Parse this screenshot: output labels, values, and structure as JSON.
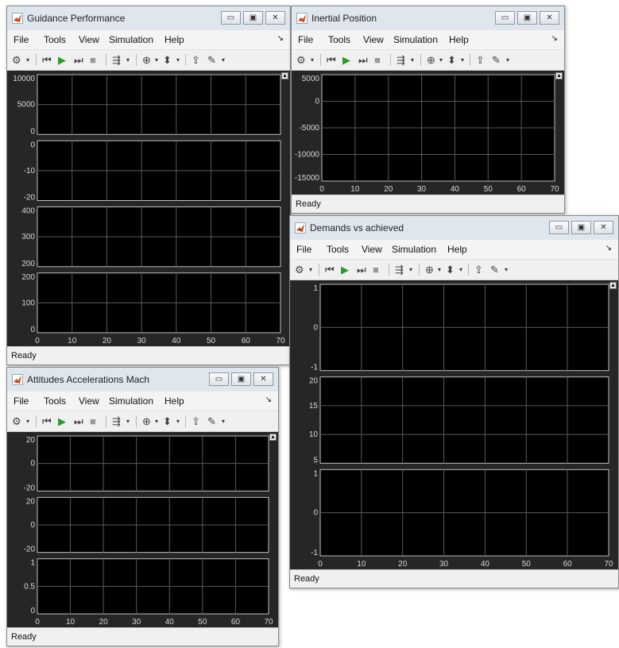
{
  "menu": [
    "File",
    "Tools",
    "View",
    "Simulation",
    "Help"
  ],
  "status_text": "Ready",
  "x_ticks": [
    "0",
    "10",
    "20",
    "30",
    "40",
    "50",
    "60",
    "70"
  ],
  "colors": {
    "scope_bg": "#262626",
    "plot_bg": "#000000",
    "grid": "#5a5a5a",
    "axes_box": "#bfbfbf",
    "tick_text": "#d8d8d8"
  },
  "icons": [
    "settings-icon",
    "step-back-icon",
    "run-icon",
    "step-forward-icon",
    "stop-icon",
    "highlight-icon",
    "zoom-icon",
    "scale-axes-icon",
    "signal-select-icon",
    "style-icon"
  ],
  "windows": [
    {
      "id": "guidance",
      "title": "Guidance Performance",
      "axes": [
        {
          "yticks": [
            "10000",
            "5000",
            "0"
          ],
          "xticks": false
        },
        {
          "yticks": [
            "0",
            "-10",
            "-20"
          ],
          "xticks": false
        },
        {
          "yticks": [
            "400",
            "300",
            "200"
          ],
          "xticks": false
        },
        {
          "yticks": [
            "200",
            "100",
            "0"
          ],
          "xticks": true
        }
      ]
    },
    {
      "id": "inertial",
      "title": "Inertial Position",
      "axes": [
        {
          "yticks": [
            "5000",
            "0",
            "-5000",
            "-10000",
            "-15000"
          ],
          "xticks": true
        }
      ]
    },
    {
      "id": "demands",
      "title": "Demands vs achieved",
      "axes": [
        {
          "yticks": [
            "1",
            "0",
            "-1"
          ],
          "xticks": false
        },
        {
          "yticks": [
            "20",
            "15",
            "10",
            "5"
          ],
          "xticks": false
        },
        {
          "yticks": [
            "1",
            "0",
            "-1"
          ],
          "xticks": true
        }
      ]
    },
    {
      "id": "attitudes",
      "title": "Attitudes Accelerations Mach",
      "axes": [
        {
          "yticks": [
            "20",
            "0",
            "-20"
          ],
          "xticks": false
        },
        {
          "yticks": [
            "20",
            "0",
            "-20"
          ],
          "xticks": false
        },
        {
          "yticks": [
            "1",
            "0.5",
            "0"
          ],
          "xticks": true
        }
      ]
    }
  ]
}
